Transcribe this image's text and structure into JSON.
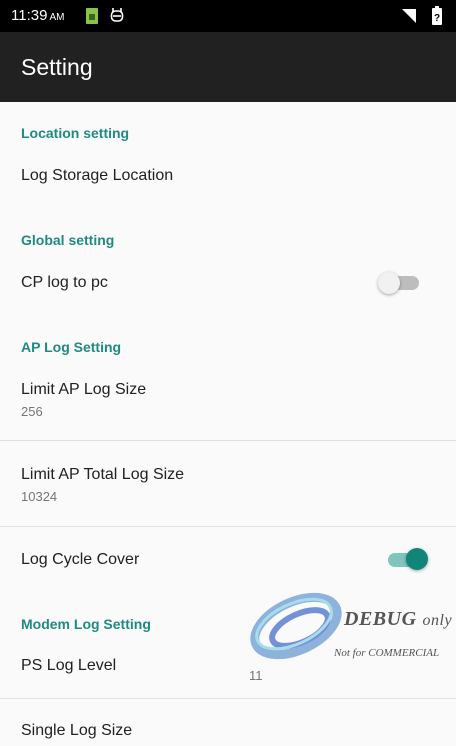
{
  "status_bar": {
    "time": "11:39",
    "ampm": "AM",
    "icons": [
      "sim-card-icon",
      "usb-debug-icon",
      "no-signal-icon",
      "battery-icon"
    ]
  },
  "app_bar": {
    "title": "Setting"
  },
  "settings": {
    "location_header": "Location setting",
    "log_storage_title": "Log Storage Location",
    "global_header": "Global setting",
    "cp_log_title": "CP log to pc",
    "cp_log_enabled": false,
    "ap_header": "AP Log Setting",
    "limit_ap_title": "Limit AP Log Size",
    "limit_ap_value": "256",
    "limit_total_title": "Limit AP Total Log Size",
    "limit_total_value": "10324",
    "cycle_cover_title": "Log Cycle Cover",
    "cycle_cover_enabled": true,
    "modem_header": "Modem Log Setting",
    "ps_level_title": "PS Log Level",
    "ps_level_value": "11",
    "single_log_title": "Single Log Size"
  },
  "watermark": {
    "line1": "DEBUG",
    "line1b": "only",
    "line2": "Not for COMMERCIAL"
  },
  "colors": {
    "accent": "#1f8a80",
    "switch_on_track": "#7fc4bd",
    "switch_on_thumb": "#118577",
    "switch_off_track": "#bdbdbd",
    "switch_off_thumb": "#f1f1f1"
  }
}
